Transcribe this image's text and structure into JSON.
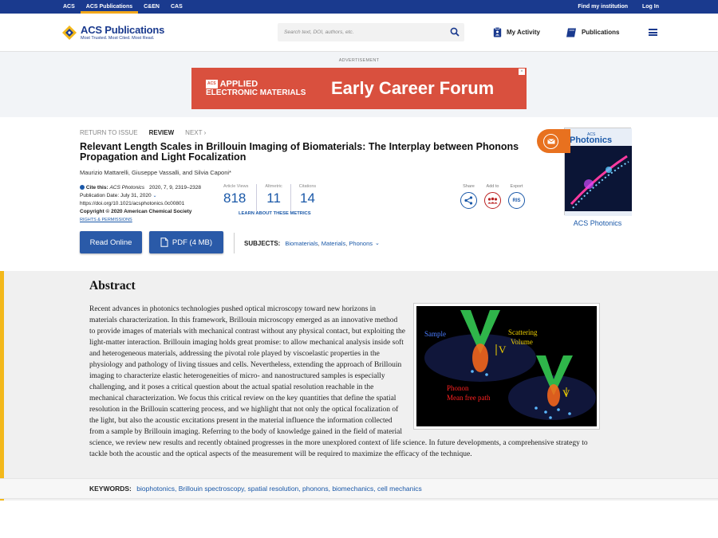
{
  "topbar": {
    "left": [
      "ACS",
      "ACS Publications",
      "C&EN",
      "CAS"
    ],
    "right": [
      "Find my institution",
      "Log In"
    ]
  },
  "header": {
    "logo_title": "ACS Publications",
    "logo_tagline": "Most Trusted. Most Cited. Most Read.",
    "search_placeholder": "Search text, DOI, authors, etc.",
    "my_activity": "My Activity",
    "publications": "Publications"
  },
  "ad": {
    "label": "ADVERTISEMENT",
    "brand_small": "ACS",
    "brand_line1": "APPLIED",
    "brand_line2": "ELECTRONIC MATERIALS",
    "headline": "Early Career Forum"
  },
  "nav": {
    "return": "RETURN TO ISSUE",
    "current": "REVIEW",
    "next": "NEXT"
  },
  "article": {
    "title": "Relevant Length Scales in Brillouin Imaging of Biomaterials: The Interplay between Phonons Propagation and Light Focalization",
    "authors": "Maurizio Mattarelli, Giuseppe Vassalli, and Silvia Caponi*",
    "cite_label": "Cite this:",
    "cite_journal": "ACS Photonics",
    "cite_ref": "2020, 7, 9, 2319–2328",
    "pub_date": "Publication Date: July 31, 2020",
    "doi": "https://doi.org/10.1021/acsphotonics.0c00801",
    "copyright": "Copyright © 2020 American Chemical Society",
    "rights": "RIGHTS & PERMISSIONS"
  },
  "metrics": [
    {
      "label": "Article Views",
      "value": "818"
    },
    {
      "label": "Altmetric",
      "value": "11"
    },
    {
      "label": "Citations",
      "value": "14"
    }
  ],
  "metrics_link": "LEARN ABOUT THESE METRICS",
  "tools": [
    {
      "label": "Share",
      "icon": "share-icon"
    },
    {
      "label": "Add to",
      "icon": "group-icon"
    },
    {
      "label": "Export",
      "text": "RIS"
    }
  ],
  "buttons": {
    "read": "Read Online",
    "pdf": "PDF (4 MB)"
  },
  "subjects": {
    "label": "SUBJECTS:",
    "items": [
      "Biomaterials",
      "Materials",
      "Phonons"
    ]
  },
  "journal": {
    "cover_title_small": "ACS",
    "cover_title": "Photonics",
    "name": "ACS Photonics"
  },
  "abstract": {
    "heading": "Abstract",
    "text": "Recent advances in photonics technologies pushed optical microscopy toward new horizons in materials characterization. In this framework, Brillouin microscopy emerged as an innovative method to provide images of materials with mechanical contrast without any physical contact, but exploiting the light-matter interaction. Brillouin imaging holds great promise: to allow mechanical analysis inside soft and heterogeneous materials, addressing the pivotal role played by viscoelastic properties in the physiology and pathology of living tissues and cells. Nevertheless, extending the approach of Brillouin imaging to characterize elastic heterogeneities of micro- and nanostructured samples is especially challenging, and it poses a critical question about the actual spatial resolution reachable in the mechanical characterization. We focus this critical review on the key quantities that define the spatial resolution in the Brillouin scattering process, and we highlight that not only the optical focalization of the light, but also the acoustic excitations present in the material influence the information collected from a sample by Brillouin imaging. Referring to the body of knowledge gained in the field of material science, we review new results and recently obtained progresses in the more unexplored context of life science. In future developments, a comprehensive strategy to tackle both the acoustic and the optical aspects of the measurement will be required to maximize the efficacy of the technique.",
    "figure": {
      "sample": "Sample",
      "scattering": "Scattering",
      "volume": "Volume",
      "v1": "V",
      "v2": "V",
      "phonon": "Phonon",
      "mean_free_path": "Mean free path"
    }
  },
  "keywords": {
    "label": "KEYWORDS:",
    "items": "biophotonics, Brillouin spectroscopy, spatial resolution, phonons, biomechanics, cell mechanics"
  },
  "colors": {
    "brand": "#1a3a8e",
    "accent": "#f3b81a",
    "link": "#1a58a8",
    "ad": "#d9503e"
  }
}
